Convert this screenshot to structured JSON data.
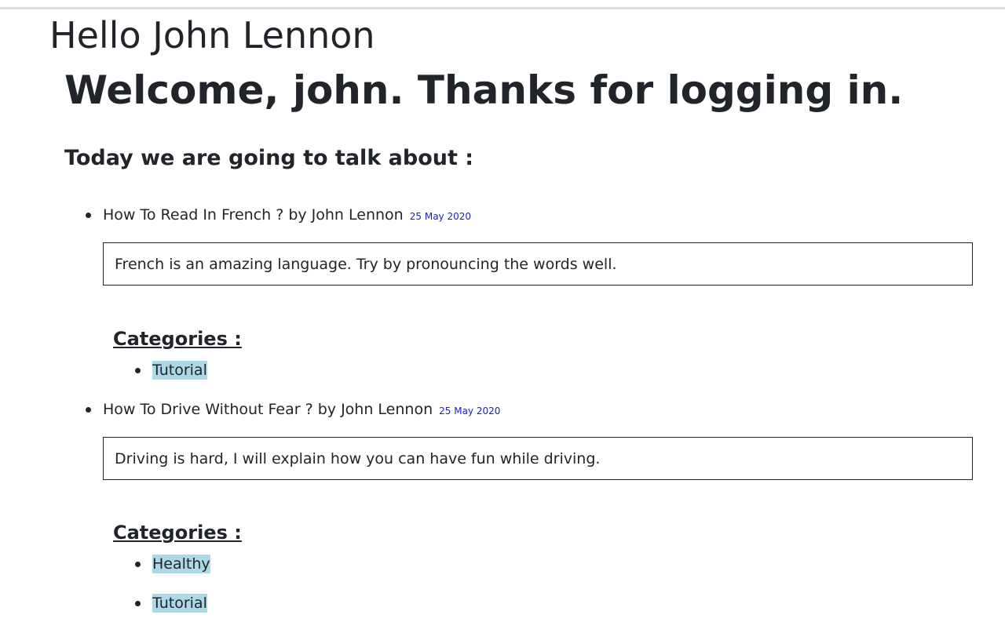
{
  "greeting": "Hello John Lennon",
  "welcome": "Welcome, john. Thanks for logging in.",
  "subheading": "Today we are going to talk about :",
  "posts": [
    {
      "title": "How To Read In French ? by John Lennon",
      "date": "25 May 2020",
      "body": "French is an amazing language. Try by pronouncing the words well.",
      "categories_label": "Categories :",
      "categories": [
        "Tutorial"
      ]
    },
    {
      "title": "How To Drive Without Fear ? by John Lennon",
      "date": "25 May 2020",
      "body": "Driving is hard, I will explain how you can have fun while driving.",
      "categories_label": "Categories :",
      "categories": [
        "Healthy",
        "Tutorial"
      ]
    }
  ],
  "colors": {
    "text": "#212529",
    "date": "#1a1ad6",
    "tag_background": "#add8e6"
  }
}
